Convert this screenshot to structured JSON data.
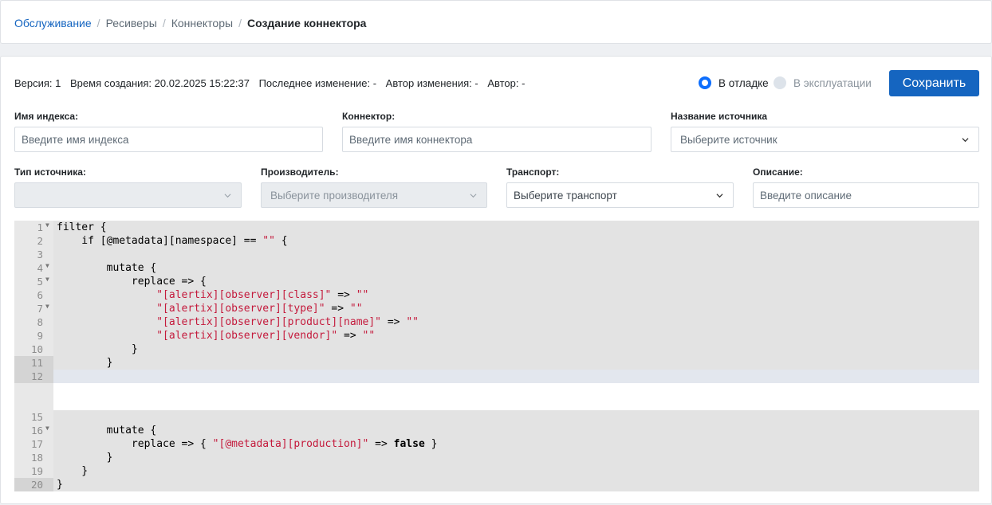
{
  "breadcrumb": {
    "items": [
      "Обслуживание",
      "Ресиверы",
      "Коннекторы"
    ],
    "current": "Создание коннектора"
  },
  "meta": {
    "version": "Версия: 1",
    "created": "Время создания: 20.02.2025 15:22:37",
    "modified": "Последнее изменение: -",
    "modified_by": "Автор изменения: -",
    "author": "Автор: -"
  },
  "status": {
    "options": [
      {
        "label": "В отладке",
        "selected": true
      },
      {
        "label": "В эксплуатации",
        "selected": false
      }
    ]
  },
  "toolbar": {
    "save_label": "Сохранить"
  },
  "form": {
    "index_name": {
      "label": "Имя индекса:",
      "placeholder": "Введите имя индекса"
    },
    "connector": {
      "label": "Коннектор:",
      "placeholder": "Введите имя коннектора"
    },
    "source_name": {
      "label": "Название источника",
      "placeholder": "Выберите источник"
    },
    "source_type": {
      "label": "Тип источника:",
      "placeholder": ""
    },
    "vendor": {
      "label": "Производитель:",
      "placeholder": "Выберите производителя"
    },
    "transport": {
      "label": "Транспорт:",
      "placeholder": "Выберите транспорт"
    },
    "description": {
      "label": "Описание:",
      "placeholder": "Введите описание"
    }
  },
  "editor": {
    "lines": [
      {
        "n": "1",
        "fold": true,
        "text": "filter {"
      },
      {
        "n": "2",
        "fold": false,
        "text": "    if [@metadata][namespace] == \"\" {"
      },
      {
        "n": "3",
        "fold": false,
        "text": ""
      },
      {
        "n": "4",
        "fold": true,
        "text": "        mutate {"
      },
      {
        "n": "5",
        "fold": true,
        "text": "            replace => {"
      },
      {
        "n": "6",
        "fold": false,
        "text": "                \"[alertix][observer][class]\" => \"\""
      },
      {
        "n": "7",
        "fold": true,
        "text": "                \"[alertix][observer][type]\" => \"\""
      },
      {
        "n": "8",
        "fold": false,
        "text": "                \"[alertix][observer][product][name]\" => \"\""
      },
      {
        "n": "9",
        "fold": false,
        "text": "                \"[alertix][observer][vendor]\" => \"\""
      },
      {
        "n": "10",
        "fold": false,
        "text": "            }"
      },
      {
        "n": "11",
        "fold": false,
        "text": "        }"
      },
      {
        "n": "12",
        "fold": false,
        "text": ""
      },
      {
        "n": "15",
        "fold": false,
        "text": ""
      },
      {
        "n": "16",
        "fold": true,
        "text": "        mutate {"
      },
      {
        "n": "17",
        "fold": false,
        "text": "            replace => { \"[@metadata][production]\" => false }"
      },
      {
        "n": "18",
        "fold": false,
        "text": "        }"
      },
      {
        "n": "19",
        "fold": false,
        "text": "    }"
      },
      {
        "n": "20",
        "fold": false,
        "text": "}"
      }
    ]
  },
  "colors": {
    "accent": "#1565c0",
    "string": "#c41a3c",
    "gutter": "#e8e8e8"
  }
}
